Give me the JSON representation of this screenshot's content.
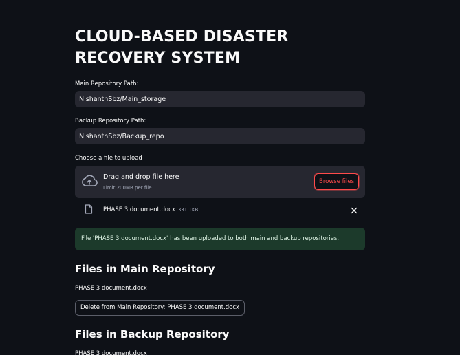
{
  "page": {
    "title": "CLOUD-BASED DISASTER RECOVERY SYSTEM"
  },
  "main_repo": {
    "label": "Main Repository Path:",
    "value": "NishanthSbz/Main_storage"
  },
  "backup_repo": {
    "label": "Backup Repository Path:",
    "value": "NishanthSbz/Backup_repo"
  },
  "uploader": {
    "label": "Choose a file to upload",
    "drag_text": "Drag and drop file here",
    "limit_text": "Limit 200MB per file",
    "browse_label": "Browse files",
    "icon": "cloud-upload-icon"
  },
  "uploaded_file": {
    "name": "PHASE 3 document.docx",
    "size": "331.1KB",
    "icon": "file-icon",
    "remove_icon": "close-icon"
  },
  "alert": {
    "message": "File 'PHASE 3 document.docx' has been uploaded to both main and backup repositories.",
    "color": "#1c3a2b"
  },
  "main_files": {
    "heading": "Files in Main Repository",
    "items": [
      "PHASE 3 document.docx"
    ],
    "delete_label": "Delete from Main Repository: PHASE 3 document.docx"
  },
  "backup_files": {
    "heading": "Files in Backup Repository",
    "items": [
      "PHASE 3 document.docx"
    ]
  },
  "colors": {
    "background": "#0e1117",
    "input_bg": "#262730",
    "accent": "#ff4b4b"
  }
}
